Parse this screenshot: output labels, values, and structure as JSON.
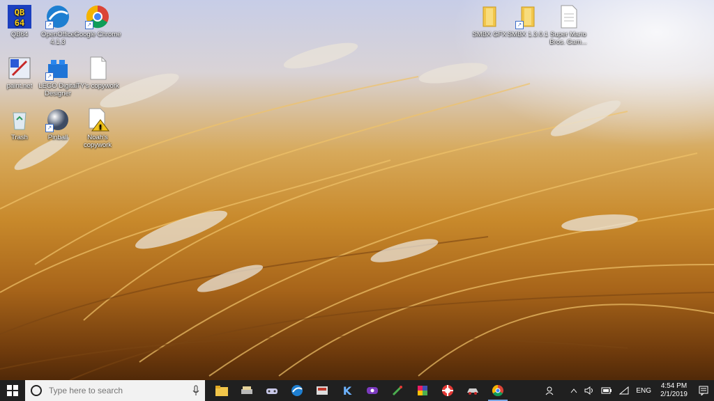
{
  "desktop": {
    "icons_left": [
      {
        "label": "QB64"
      },
      {
        "label": "OpenOffice 4.1.3"
      },
      {
        "label": "Google Chrome"
      },
      {
        "label": "paint.net"
      },
      {
        "label": "LEGO Digital Designer"
      },
      {
        "label": "TY's copywork"
      },
      {
        "label": "Trash"
      },
      {
        "label": "Pinball"
      },
      {
        "label": "Noah's copywork"
      }
    ],
    "icons_right": [
      {
        "label": "SMBX GFX"
      },
      {
        "label": "SMBX 1.3.0.1"
      },
      {
        "label": "Super Mario Bros. Gam..."
      }
    ]
  },
  "taskbar": {
    "search_placeholder": "Type here to search",
    "language": "ENG",
    "time": "4:54 PM",
    "date": "2/1/2019"
  }
}
